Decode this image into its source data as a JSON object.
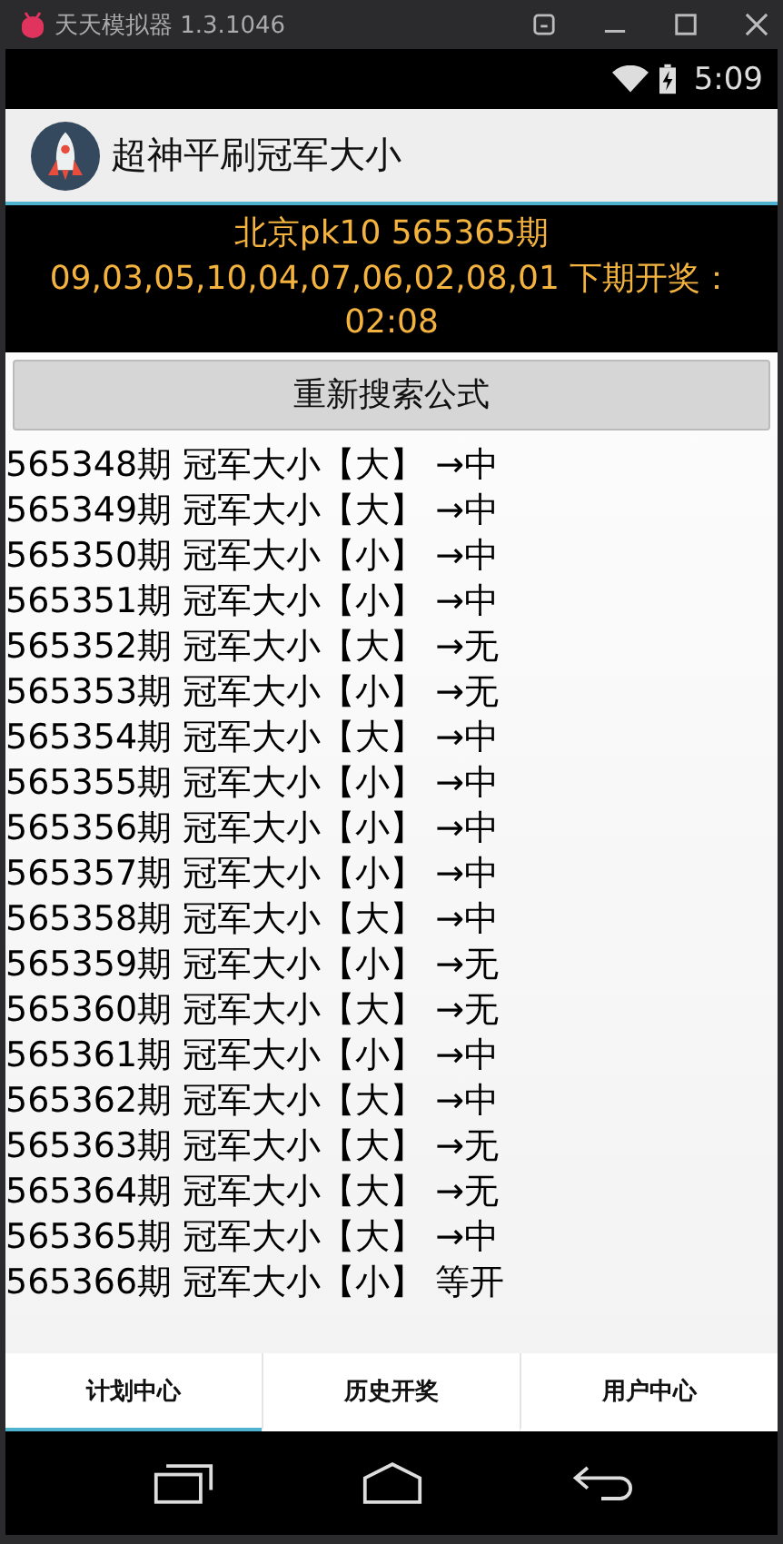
{
  "emulator": {
    "title": "天天模拟器 1.3.1046"
  },
  "status_bar": {
    "time": "5:09"
  },
  "app_bar": {
    "title": "超神平刷冠军大小"
  },
  "draw_info": {
    "lines": [
      "北京pk10 565365期",
      "09,03,05,10,04,07,06,02,08,01 下期开奖：",
      "02:08"
    ]
  },
  "search_button": "重新搜索公式",
  "rows": [
    "565348期 冠军大小【大】 →中",
    "565349期 冠军大小【大】 →中",
    "565350期 冠军大小【小】 →中",
    "565351期 冠军大小【小】 →中",
    "565352期 冠军大小【大】 →无",
    "565353期 冠军大小【小】 →无",
    "565354期 冠军大小【大】 →中",
    "565355期 冠军大小【小】 →中",
    "565356期 冠军大小【小】 →中",
    "565357期 冠军大小【小】 →中",
    "565358期 冠军大小【大】 →中",
    "565359期 冠军大小【小】 →无",
    "565360期 冠军大小【大】 →无",
    "565361期 冠军大小【小】 →中",
    "565362期 冠军大小【大】 →中",
    "565363期 冠军大小【大】 →无",
    "565364期 冠军大小【大】 →无",
    "565365期 冠军大小【大】 →中",
    "565366期 冠军大小【小】 等开"
  ],
  "tabs": [
    {
      "label": "计划中心",
      "selected": true
    },
    {
      "label": "历史开奖",
      "selected": false
    },
    {
      "label": "用户中心",
      "selected": false
    }
  ]
}
